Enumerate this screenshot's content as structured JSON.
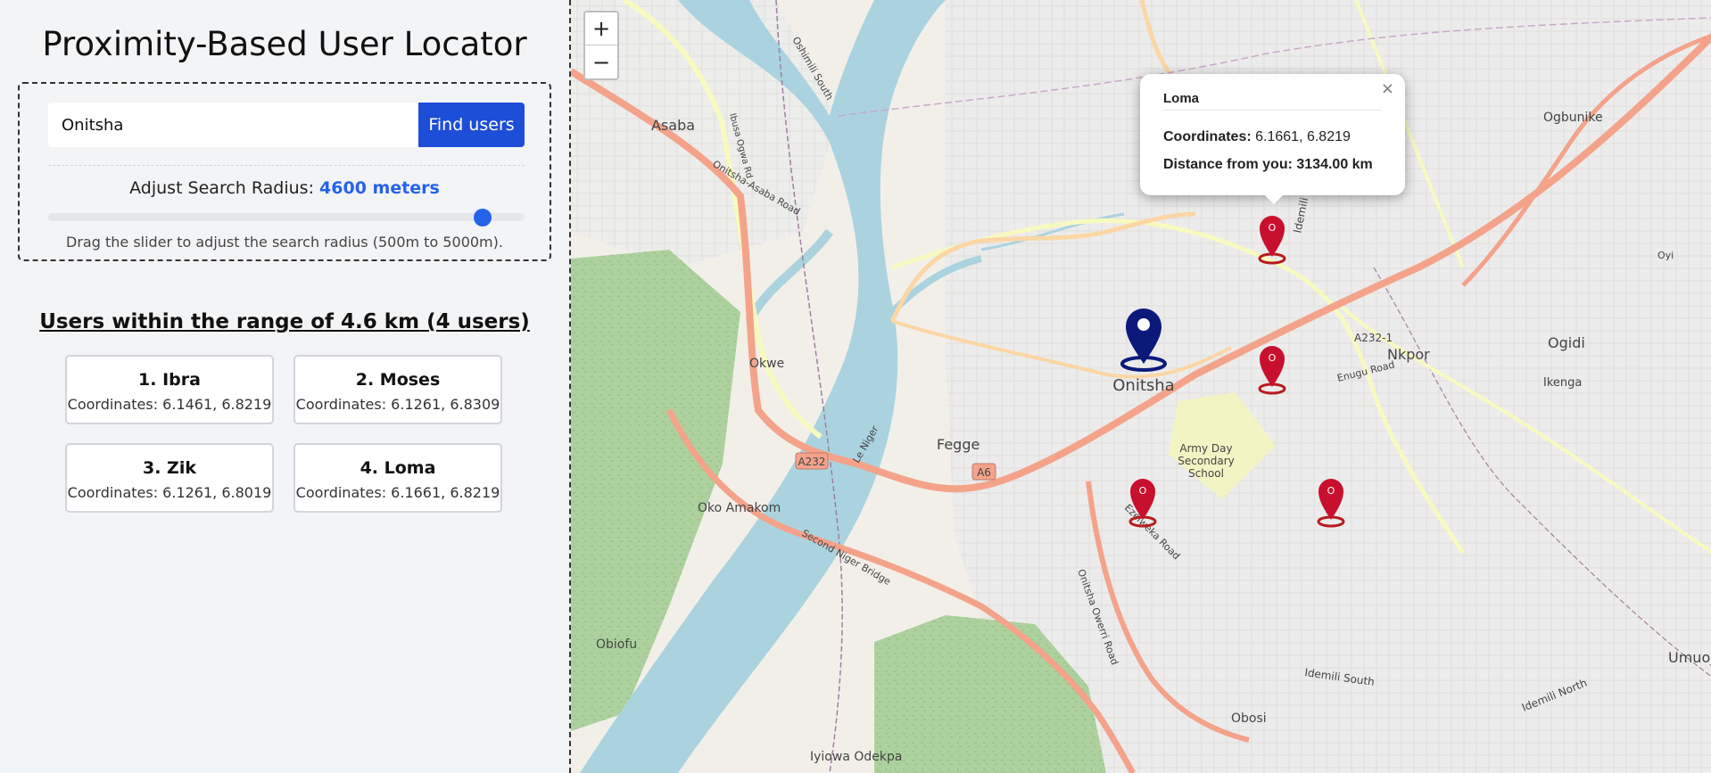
{
  "app": {
    "title": "Proximity-Based User Locator"
  },
  "search": {
    "value": "Onitsha",
    "button_label": "Find users",
    "radius_label": "Adjust Search Radius:",
    "radius_value": "4600 meters",
    "radius_meters": 4600,
    "radius_min": 500,
    "radius_max": 5000,
    "hint": "Drag the slider to adjust the search radius (500m to 5000m)."
  },
  "results": {
    "heading": "Users within the range of 4.6 km (4 users)",
    "users": [
      {
        "name": "1. Ibra",
        "coords": "Coordinates: 6.1461, 6.8219"
      },
      {
        "name": "2. Moses",
        "coords": "Coordinates: 6.1261, 6.8309"
      },
      {
        "name": "3. Zik",
        "coords": "Coordinates: 6.1261, 6.8019"
      },
      {
        "name": "4. Loma",
        "coords": "Coordinates: 6.1661, 6.8219"
      }
    ]
  },
  "map": {
    "zoom_in": "+",
    "zoom_out": "−",
    "labels": {
      "asaba": "Asaba",
      "okwe": "Okwe",
      "fegge": "Fegge",
      "oko_amakom": "Oko Amakom",
      "obiofu": "Obiofu",
      "iyiowa": "Iyiowa Odekpa",
      "onitsha": "Onitsha",
      "ogbunike": "Ogbunike",
      "nkpor": "Nkpor",
      "ogidi": "Ogidi",
      "ikenga": "Ikenga",
      "umuoji": "Umuoj",
      "obosi": "Obosi",
      "army_day": "Army Day",
      "secondary": "Secondary",
      "school": "School",
      "a232": "A232",
      "a6": "A6",
      "idemili_south": "Idemili South",
      "idemili_north": "Idemili North",
      "second_niger": "Second Niger Bridge",
      "onitsha_owerri": "Onitsha Owerri Road",
      "onitsha_asaba": "Onitsha-Asaba Road",
      "ibusa_ogwa": "Ibusa Ogwa Rd",
      "ezeiweka": "Ezeiweka Road",
      "oshimili_south": "Oshimili South",
      "route_a232_1": "A232-1",
      "enugu_road": "Enugu Road",
      "le_niger": "Le Niger",
      "oyi": "Oyi"
    },
    "popup": {
      "close": "×",
      "title": "Loma",
      "coords_label": "Coordinates:",
      "coords_value": "6.1661, 6.8219",
      "distance_label": "Distance from you:",
      "distance_value": "3134.00 km"
    },
    "marker_glyph": "O"
  }
}
